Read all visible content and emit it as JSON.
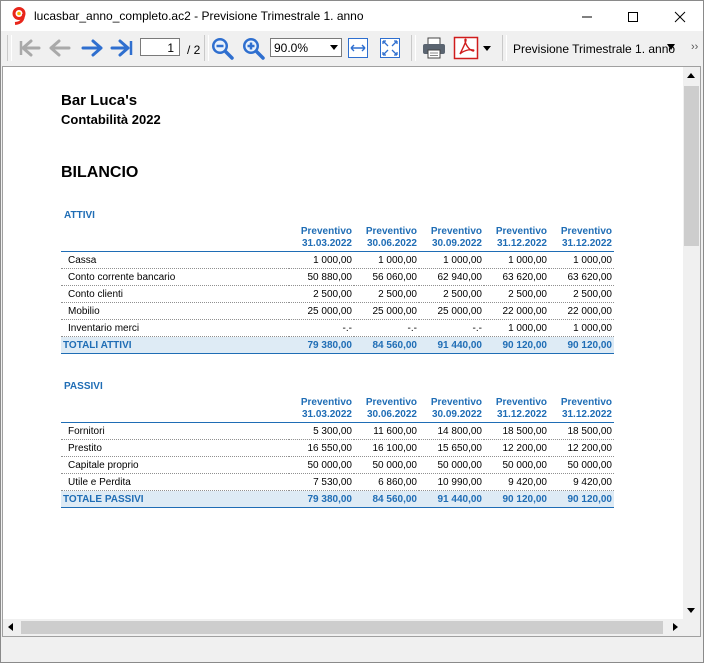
{
  "window": {
    "title": "lucasbar_anno_completo.ac2 - Previsione Trimestrale 1. anno",
    "app_icon": "banana-9-logo-icon",
    "controls": [
      "minimize-icon",
      "maximize-icon",
      "close-icon"
    ]
  },
  "toolbar": {
    "page_current": "1",
    "page_total": "/ 2",
    "zoom": "90.0%",
    "report_name": "Previsione Trimestrale 1. anno",
    "more": "››",
    "icons": [
      "first-page-icon",
      "previous-page-icon",
      "next-page-icon",
      "last-page-icon",
      "zoom-out-icon",
      "zoom-in-icon",
      "fit-width-icon",
      "fit-page-icon",
      "print-icon",
      "pdf-icon"
    ]
  },
  "report": {
    "company": "Bar Luca's",
    "subtitle": "Contabilità 2022",
    "title": "BILANCIO",
    "assets": {
      "label": "ATTIVI",
      "headers": [
        {
          "top": "Preventivo",
          "bottom": "31.03.2022"
        },
        {
          "top": "Preventivo",
          "bottom": "30.06.2022"
        },
        {
          "top": "Preventivo",
          "bottom": "30.09.2022"
        },
        {
          "top": "Preventivo",
          "bottom": "31.12.2022"
        },
        {
          "top": "Preventivo",
          "bottom": "31.12.2022"
        }
      ],
      "rows": [
        {
          "label": "Cassa",
          "values": [
            "1 000,00",
            "1 000,00",
            "1 000,00",
            "1 000,00",
            "1 000,00"
          ]
        },
        {
          "label": "Conto corrente bancario",
          "values": [
            "50 880,00",
            "56 060,00",
            "62 940,00",
            "63 620,00",
            "63 620,00"
          ]
        },
        {
          "label": "Conto clienti",
          "values": [
            "2 500,00",
            "2 500,00",
            "2 500,00",
            "2 500,00",
            "2 500,00"
          ]
        },
        {
          "label": "Mobilio",
          "values": [
            "25 000,00",
            "25 000,00",
            "25 000,00",
            "22 000,00",
            "22 000,00"
          ]
        },
        {
          "label": "Inventario merci",
          "values": [
            "-.-",
            "-.-",
            "-.-",
            "1 000,00",
            "1 000,00"
          ]
        }
      ],
      "total": {
        "label": "TOTALI ATTIVI",
        "values": [
          "79 380,00",
          "84 560,00",
          "91 440,00",
          "90 120,00",
          "90 120,00"
        ]
      }
    },
    "liabilities": {
      "label": "PASSIVI",
      "headers": [
        {
          "top": "Preventivo",
          "bottom": "31.03.2022"
        },
        {
          "top": "Preventivo",
          "bottom": "30.06.2022"
        },
        {
          "top": "Preventivo",
          "bottom": "30.09.2022"
        },
        {
          "top": "Preventivo",
          "bottom": "31.12.2022"
        },
        {
          "top": "Preventivo",
          "bottom": "31.12.2022"
        }
      ],
      "rows": [
        {
          "label": "Fornitori",
          "values": [
            "5 300,00",
            "11 600,00",
            "14 800,00",
            "18 500,00",
            "18 500,00"
          ]
        },
        {
          "label": "Prestito",
          "values": [
            "16 550,00",
            "16 100,00",
            "15 650,00",
            "12 200,00",
            "12 200,00"
          ]
        },
        {
          "label": "Capitale proprio",
          "values": [
            "50 000,00",
            "50 000,00",
            "50 000,00",
            "50 000,00",
            "50 000,00"
          ]
        },
        {
          "label": "Utile e Perdita",
          "values": [
            "7 530,00",
            "6 860,00",
            "10 990,00",
            "9 420,00",
            "9 420,00"
          ]
        }
      ],
      "total": {
        "label": "TOTALE PASSIVI",
        "values": [
          "79 380,00",
          "84 560,00",
          "91 440,00",
          "90 120,00",
          "90 120,00"
        ]
      }
    }
  }
}
